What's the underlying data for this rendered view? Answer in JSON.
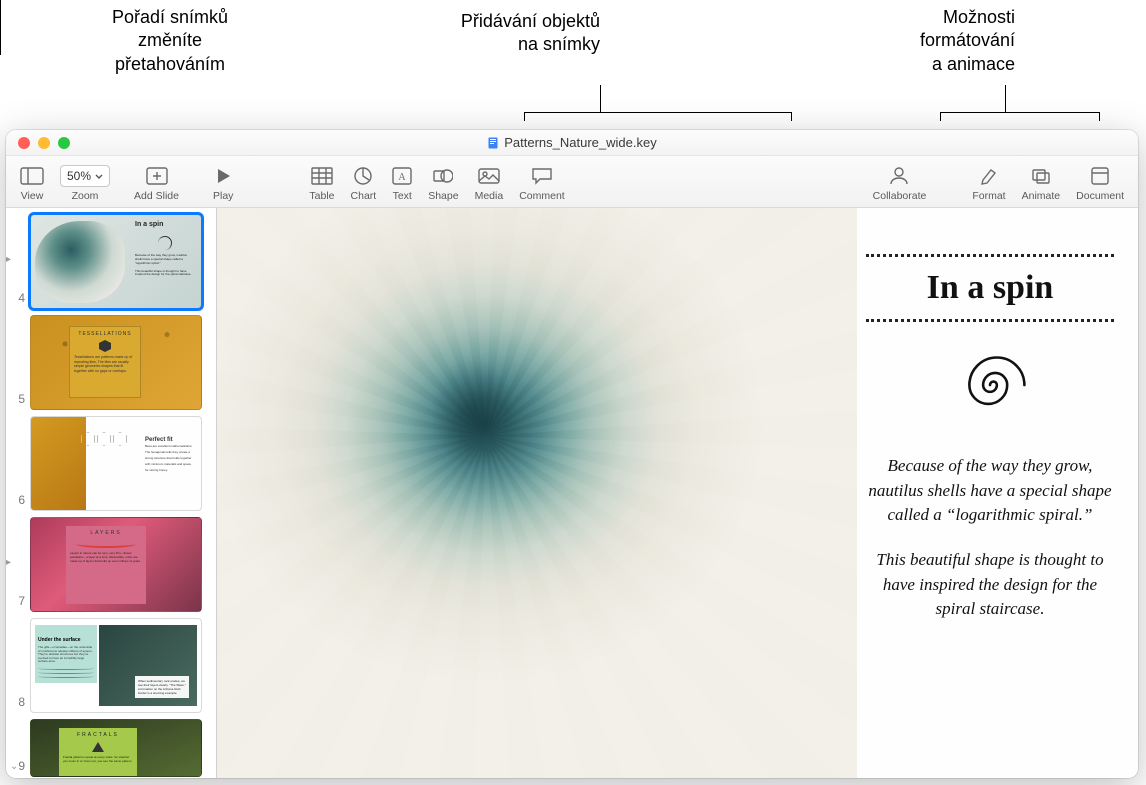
{
  "callouts": {
    "reorder": "Pořadí snímků\nzměníte\npřetahováním",
    "addObjects": "Přidávání objektů\nna snímky",
    "formatAnim": "Možnosti\nformátování\na animace"
  },
  "window": {
    "filename": "Patterns_Nature_wide.key"
  },
  "toolbar": {
    "view": "View",
    "zoom": "Zoom",
    "zoom_value": "50%",
    "addSlide": "Add Slide",
    "play": "Play",
    "table": "Table",
    "chart": "Chart",
    "text": "Text",
    "shape": "Shape",
    "media": "Media",
    "comment": "Comment",
    "collaborate": "Collaborate",
    "format": "Format",
    "animate": "Animate",
    "document": "Document"
  },
  "thumbnails": [
    {
      "num": "4",
      "label": "In a spin",
      "selected": true
    },
    {
      "num": "5",
      "label": "TESSELLATIONS"
    },
    {
      "num": "6",
      "label": "Perfect fit"
    },
    {
      "num": "7",
      "label": "LAYERS"
    },
    {
      "num": "8",
      "label": "Under the surface"
    },
    {
      "num": "9",
      "label": "FRACTALS"
    }
  ],
  "slide": {
    "title": "In a spin",
    "para1": "Because of the way they grow, nautilus shells have a special shape called a “logarithmic spiral.”",
    "para2": "This beautiful shape is thought to have inspired the design for the spiral staircase."
  }
}
